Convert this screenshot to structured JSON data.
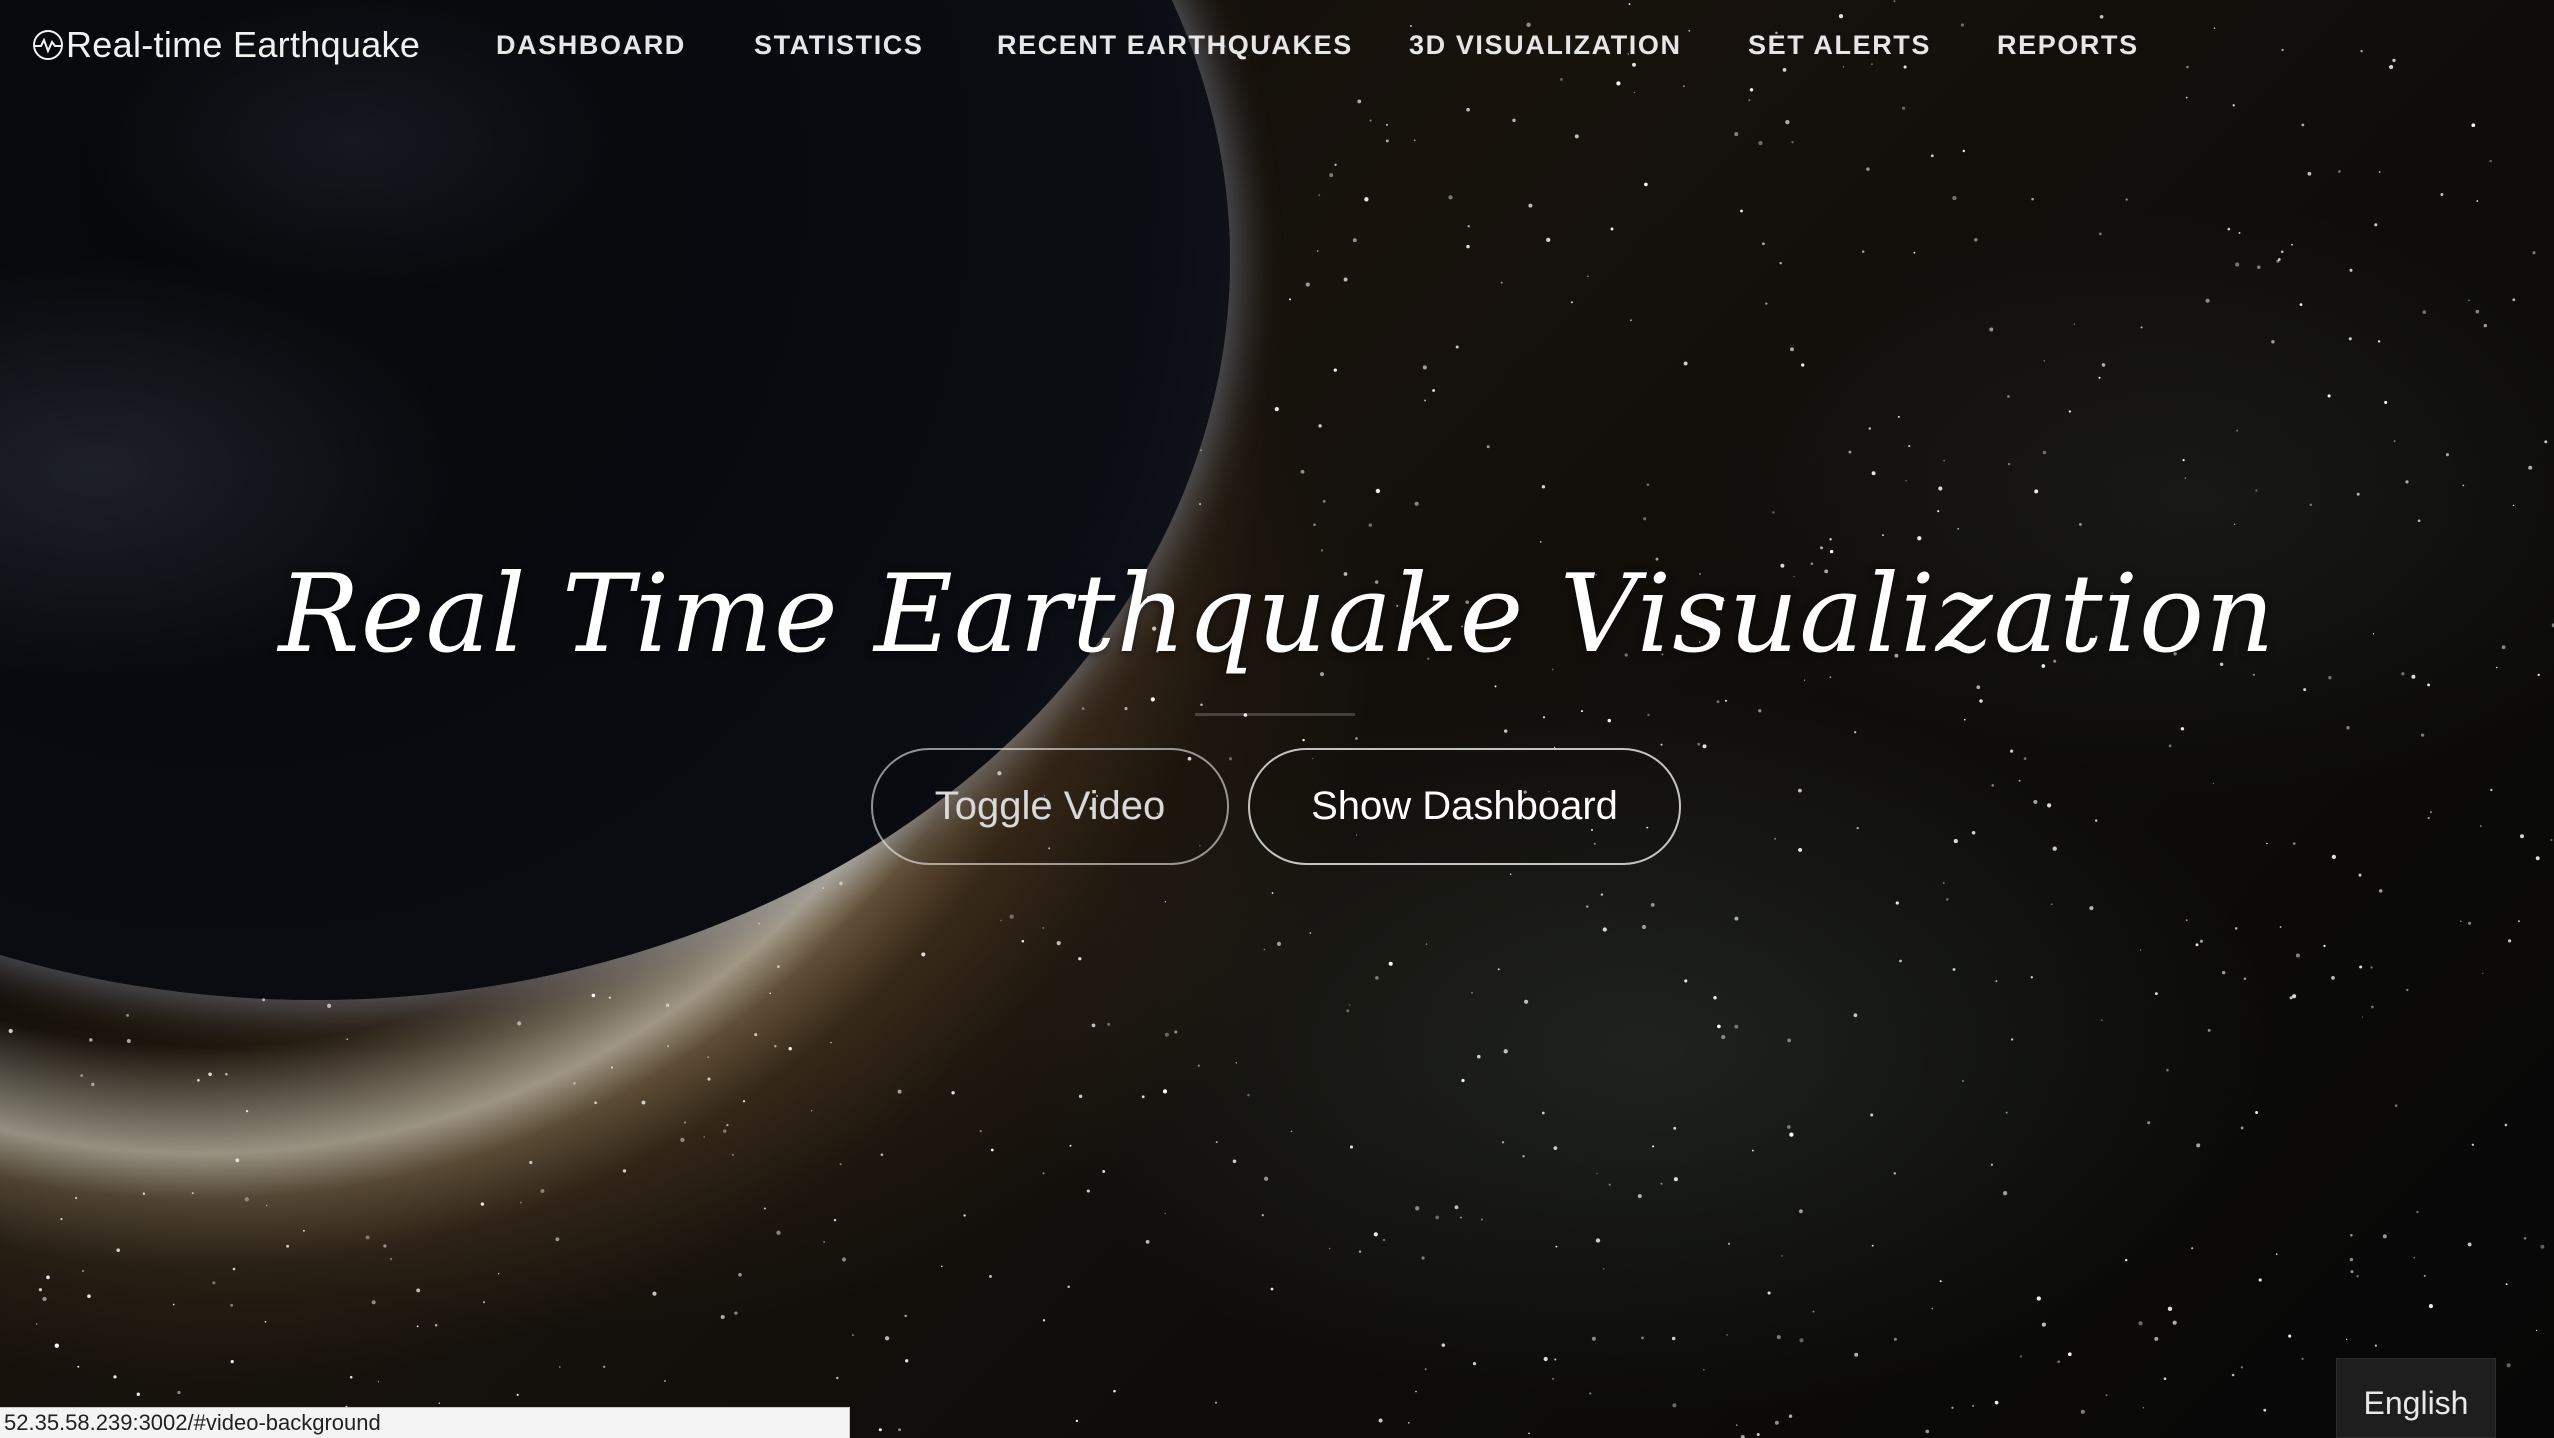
{
  "brand": {
    "name": "Real-time Earthquake",
    "icon": "seismic-wave-icon"
  },
  "nav": {
    "items": [
      {
        "label": "DASHBOARD"
      },
      {
        "label": "STATISTICS"
      },
      {
        "label": "RECENT EARTHQUAKES"
      },
      {
        "label": "3D VISUALIZATION"
      },
      {
        "label": "SET ALERTS"
      },
      {
        "label": "REPORTS"
      }
    ]
  },
  "hero": {
    "title": "Real Time Earthquake Visualization",
    "toggle_label": "Toggle Video",
    "dashboard_label": "Show Dashboard"
  },
  "status_bar": {
    "url": "52.35.58.239:3002/#video-background"
  },
  "language": {
    "label": "English"
  },
  "colors": {
    "text": "#ffffff",
    "nav_text": "#e6e6e6",
    "earth_rim": "#8fa6d6",
    "language_bg": "#1e1e1e"
  }
}
